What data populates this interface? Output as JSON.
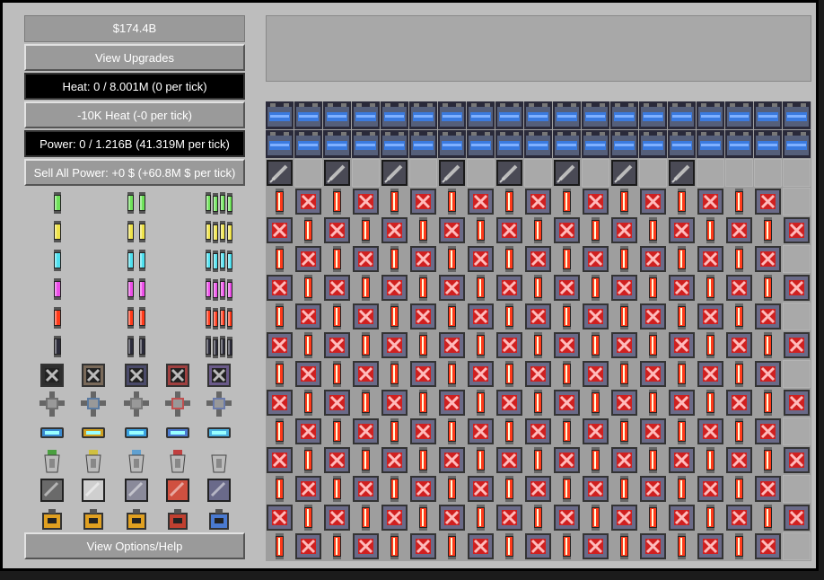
{
  "stats": {
    "money": "$174.4B",
    "view_upgrades": "View Upgrades",
    "heat": "Heat: 0 / 8.001M (0 per tick)",
    "reduce_heat": "-10K Heat (-0 per tick)",
    "power": "Power: 0 / 1.216B (41.319M per tick)",
    "sell_power": "Sell All Power: +0 $ (+60.8M $ per tick)",
    "options": "View Options/Help"
  },
  "shop": {
    "cell_rows": [
      {
        "name": "green-fuel-cell",
        "color": "#6fe25a",
        "count": [
          1,
          2,
          4
        ]
      },
      {
        "name": "yellow-fuel-cell",
        "color": "#efe34a",
        "count": [
          1,
          2,
          4
        ]
      },
      {
        "name": "cyan-fuel-cell",
        "color": "#4fe0ef",
        "count": [
          1,
          2,
          4
        ]
      },
      {
        "name": "magenta-fuel-cell",
        "color": "#ec4fe8",
        "count": [
          1,
          2,
          4
        ]
      },
      {
        "name": "red-fuel-cell",
        "color": "#ff3a1a",
        "count": [
          1,
          2,
          4
        ]
      },
      {
        "name": "black-fuel-cell",
        "color": "#2b2b3a",
        "count": [
          1,
          2,
          4
        ]
      }
    ],
    "vents": [
      "#2e2e2e",
      "#7a6a5a",
      "#4a4a6a",
      "#a04040",
      "#6a5a8a"
    ],
    "exchangers": [
      "#707070",
      "#5a7aa0",
      "#7a7a7a",
      "#c05050",
      "#6a7aaa"
    ],
    "coolants": [
      "#3a8ad0",
      "#d0a020",
      "#3aa0e0",
      "#4a7ad0",
      "#4ab0e0"
    ],
    "inlets": [
      "#4aa040",
      "#d0c040",
      "#60a0d0",
      "#c04040",
      "#c0c0c0"
    ],
    "plates": [
      "#6a6a6a",
      "#cfcfcf",
      "#8a8a9a",
      "#d05040",
      "#6a6a8a"
    ],
    "capacitors": [
      "#e0a020",
      "#e0a020",
      "#e0a020",
      "#c04030",
      "#4a7ad0"
    ]
  },
  "reactor": {
    "rows": 16,
    "cols": 19,
    "cells": [
      "CCCCCCCCCCCCCCCCCCC",
      "CCCCCCCCCCCCCCCCCCC",
      "P.P.P.P.P.P.P.P....",
      "RVRVRVRVRVRVRVRVRV.",
      "VRVRVRVRVRVRVRVRVRV",
      "RVRVRVRVRVRVRVRVRV.",
      "VRVRVRVRVRVRVRVRVRV",
      "RVRVRVRVRVRVRVRVRV.",
      "VRVRVRVRVRVRVRVRVRV",
      "RVRVRVRVRVRVRVRVRV.",
      "VRVRVRVRVRVRVRVRVRV",
      "RVRVRVRVRVRVRVRVRV.",
      "VRVRVRVRVRVRVRVRVRV",
      "RVRVRVRVRVRVRVRVRV.",
      "VRVRVRVRVRVRVRVRVRV",
      "RVRVRVRVRVRVRVRVRV."
    ]
  },
  "colors": {
    "capacitor": "#3a7adf",
    "vent": "#e03030",
    "fuel": "#ff3a1a",
    "plate": "#4a4a55"
  }
}
